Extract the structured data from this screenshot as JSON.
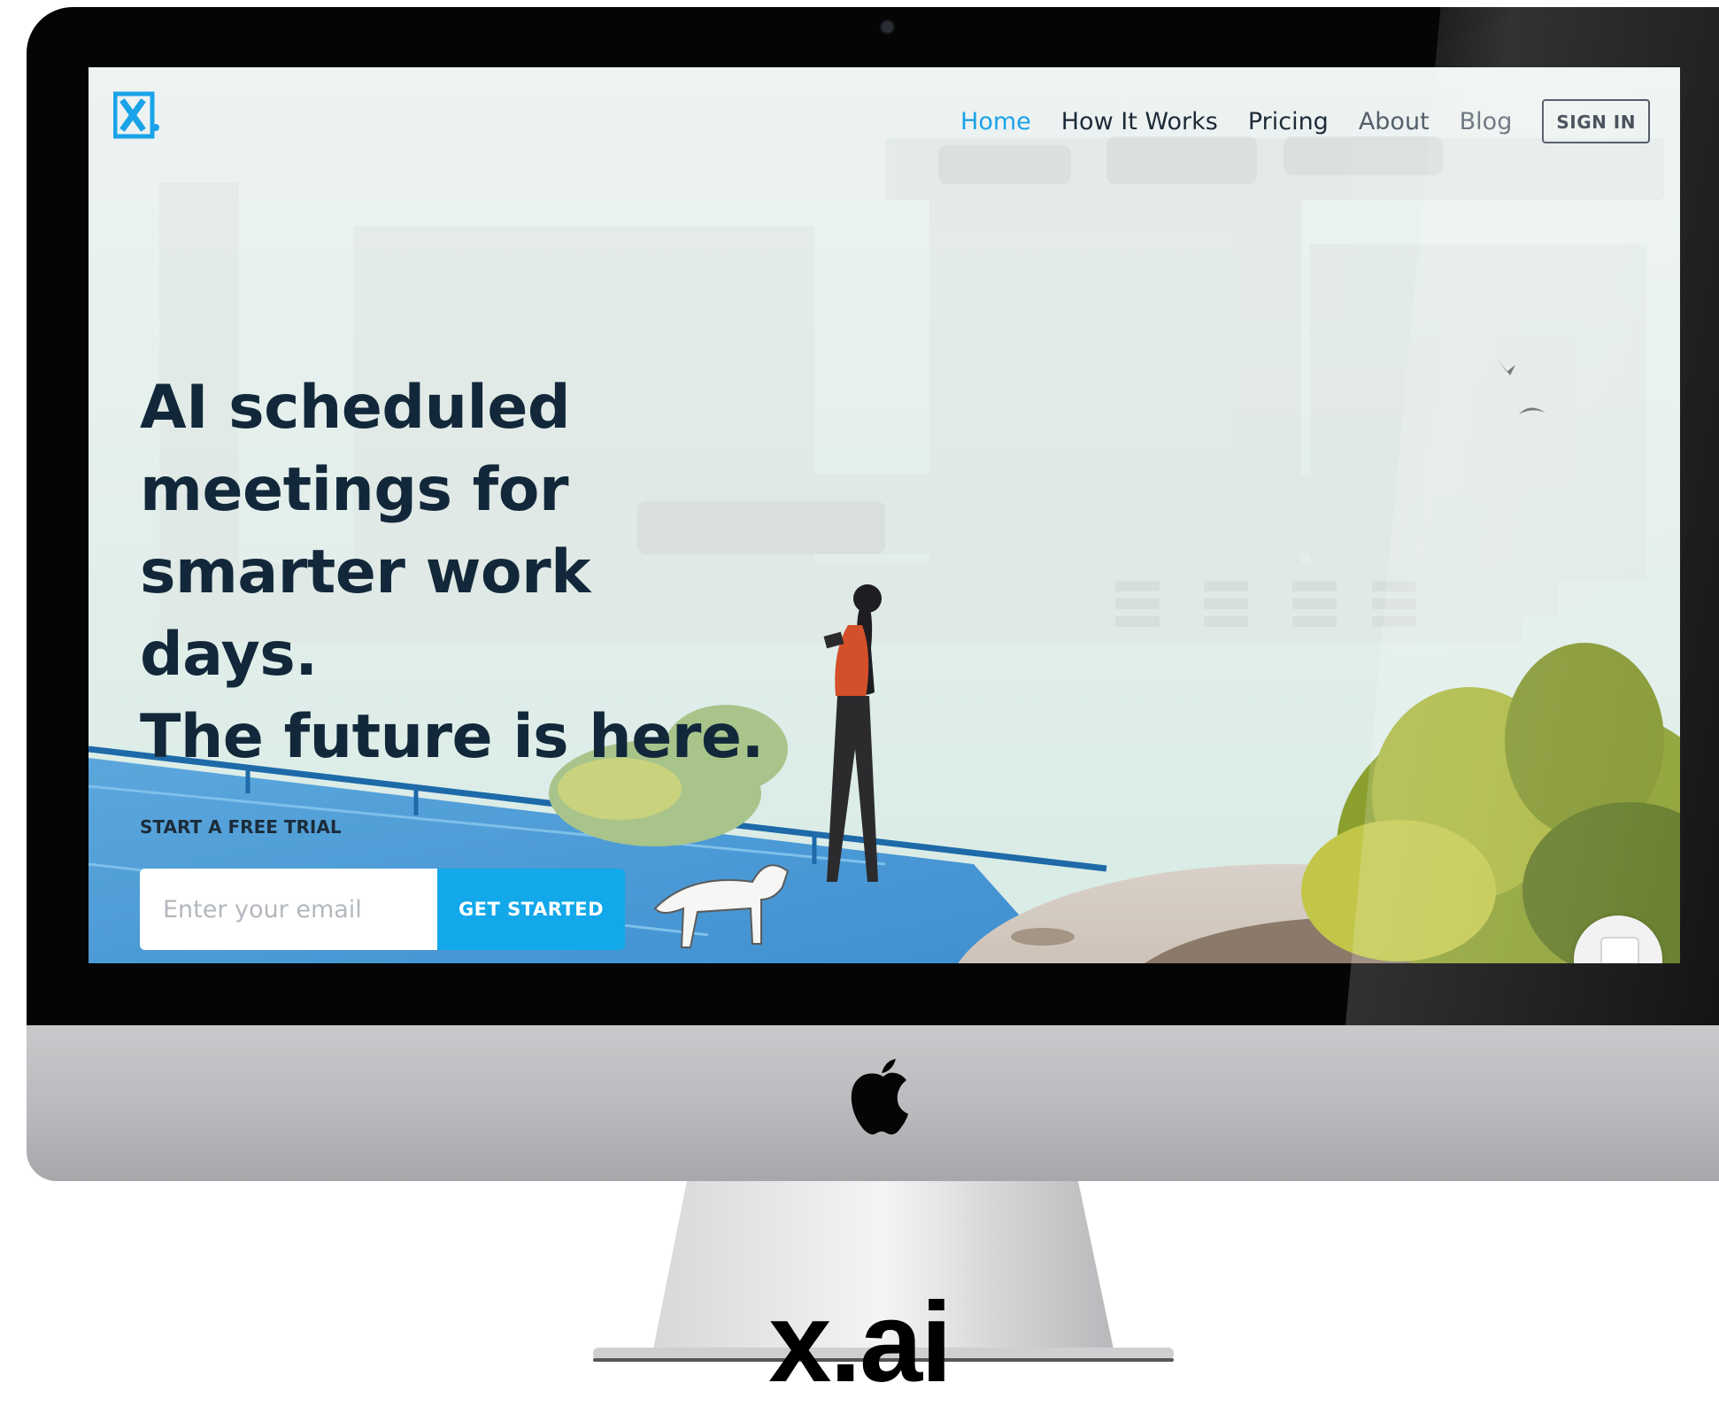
{
  "nav": {
    "links": [
      "Home",
      "How It Works",
      "Pricing",
      "About",
      "Blog"
    ],
    "active": "Home",
    "signin_label": "SIGN IN"
  },
  "hero": {
    "title_lines": [
      "AI scheduled",
      "meetings for",
      "smarter work",
      "days.",
      "The future is here."
    ],
    "trial_label": "START A FREE TRIAL",
    "email_placeholder": "Enter your email",
    "cta_label": "GET STARTED"
  },
  "caption": "x.ai",
  "colors": {
    "accent": "#12a8ea",
    "heading": "#12283a",
    "bezel": "#050505",
    "chin": "#bcbdc0"
  },
  "icons": [
    "x-logo-icon",
    "apple-logo-icon",
    "chat-icon"
  ]
}
